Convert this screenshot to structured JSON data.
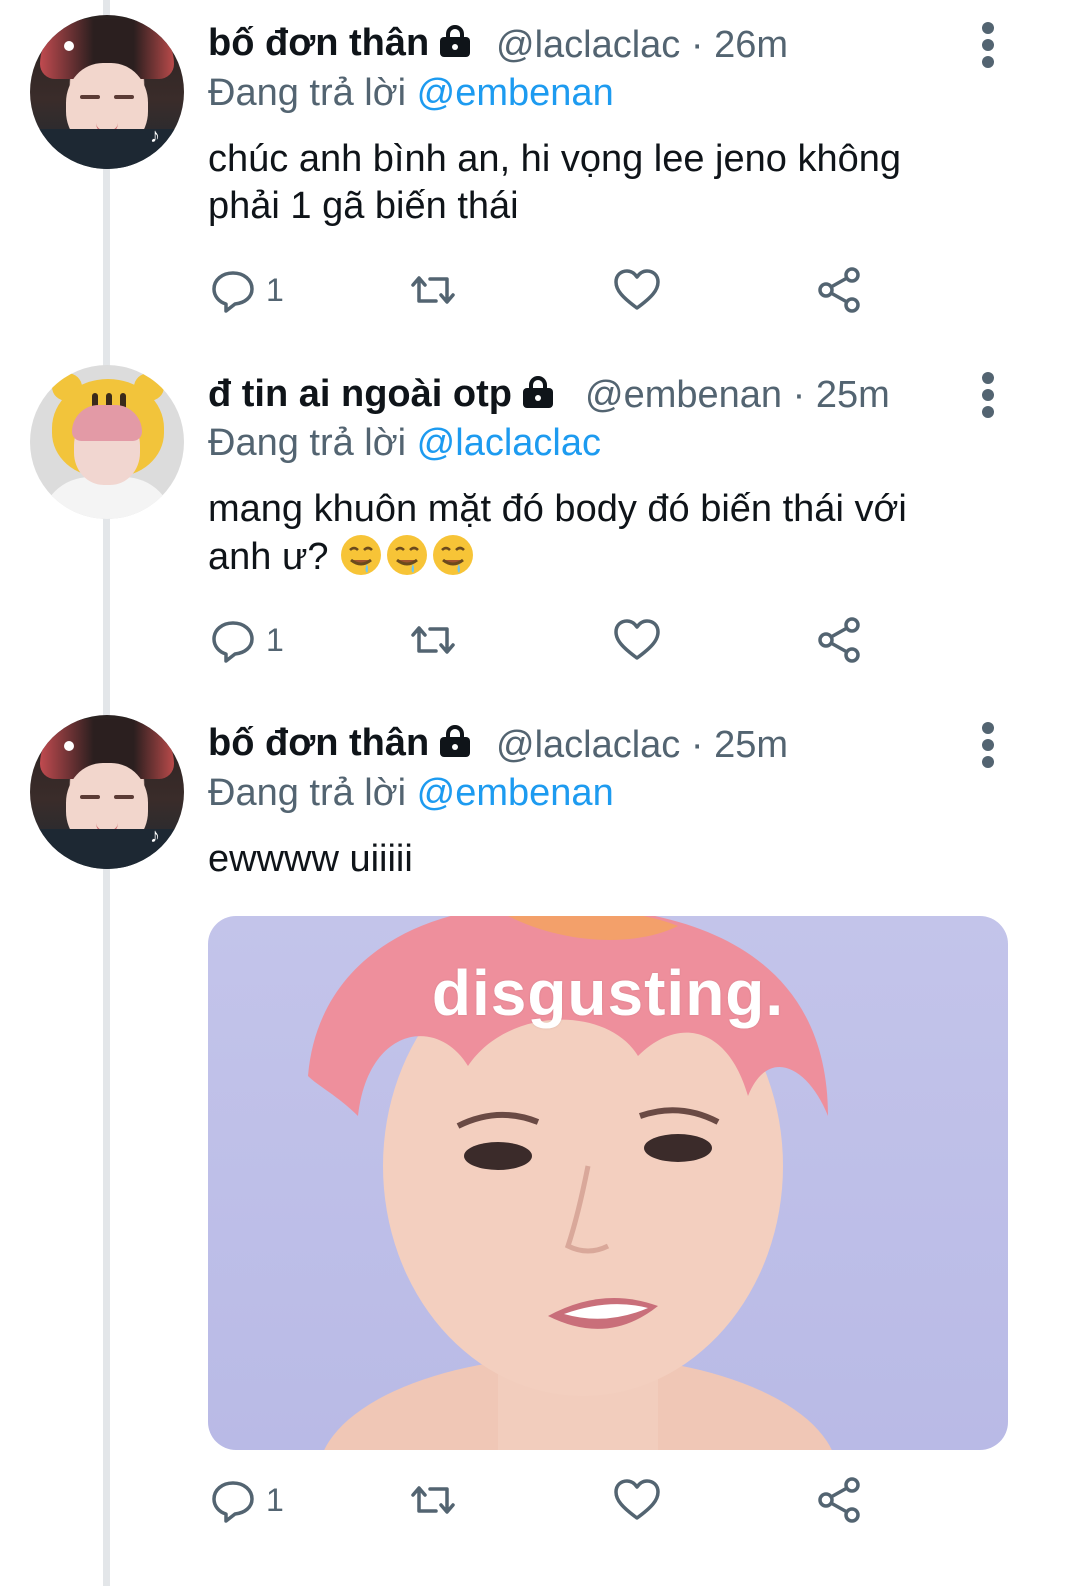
{
  "tweets": [
    {
      "display_name": "bố đơn thân",
      "handle": "@laclaclac",
      "time": "· 26m",
      "replying_prefix": "Đang trả lời",
      "replying_to": "@embenan",
      "text_line1": "chúc anh bình an, hi vọng lee jeno không",
      "text_line2": "phải 1 gã biến thái",
      "reply_count": "1"
    },
    {
      "display_name": "đ tin ai ngoài otp",
      "handle": "@embenan",
      "time": "· 25m",
      "replying_prefix": "Đang trả lời",
      "replying_to": "@laclaclac",
      "text_line1": "mang khuôn mặt đó body đó biến thái với",
      "text_line2": "anh ư?",
      "emoji": [
        "drooling-face",
        "drooling-face",
        "drooling-face"
      ],
      "reply_count": "1"
    },
    {
      "display_name": "bố đơn thân",
      "handle": "@laclaclac",
      "time": "· 25m",
      "replying_prefix": "Đang trả lời",
      "replying_to": "@embenan",
      "text_line1": "ewwww uiiiii",
      "media_caption": "disgusting.",
      "reply_count": "1"
    }
  ],
  "colors": {
    "text": "#0f1419",
    "secondary": "#536471",
    "mention": "#1d9bf0",
    "thread_line": "#e3e6e9",
    "media_bg": "#c3c4ea"
  },
  "icons": [
    "lock-icon",
    "more-icon",
    "reply-icon",
    "retweet-icon",
    "like-icon",
    "share-icon"
  ]
}
